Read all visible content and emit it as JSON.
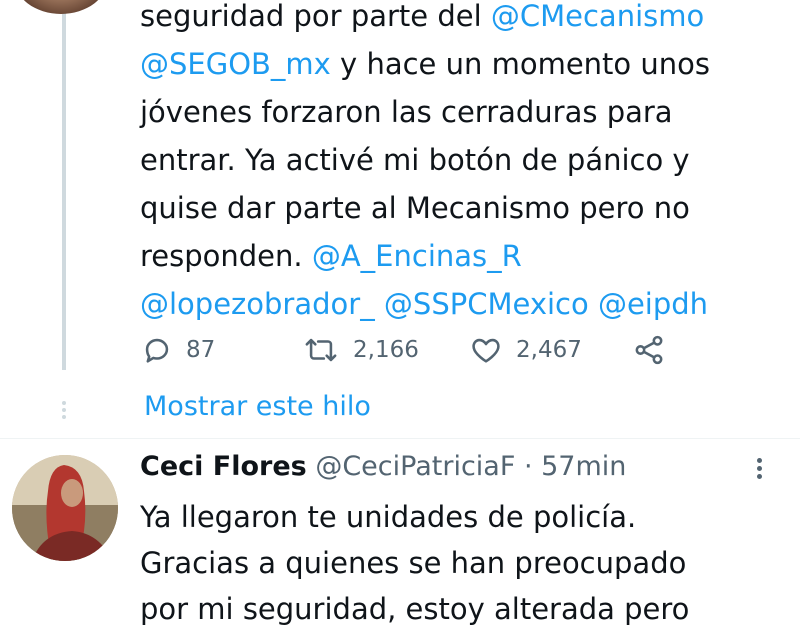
{
  "tweet1": {
    "lines": [
      [
        {
          "t": "seguridad por parte del ",
          "m": false
        },
        {
          "t": "@CMecanismo",
          "m": true
        }
      ],
      [
        {
          "t": "@SEGOB_mx",
          "m": true
        },
        {
          "t": " y hace un momento unos",
          "m": false
        }
      ],
      [
        {
          "t": "jóvenes forzaron las cerraduras para",
          "m": false
        }
      ],
      [
        {
          "t": "entrar. Ya activé mi botón de pánico y",
          "m": false
        }
      ],
      [
        {
          "t": "quise dar parte al Mecanismo pero no",
          "m": false
        }
      ],
      [
        {
          "t": "responden. ",
          "m": false
        },
        {
          "t": "@A_Encinas_R",
          "m": true
        }
      ],
      [
        {
          "t": "@lopezobrador_",
          "m": true
        },
        {
          "t": " ",
          "m": false
        },
        {
          "t": "@SSPCMexico",
          "m": true
        },
        {
          "t": " ",
          "m": false
        },
        {
          "t": "@eipdh",
          "m": true
        }
      ]
    ],
    "actions": {
      "reply_count": "87",
      "retweet_count": "2,166",
      "like_count": "2,467"
    },
    "icons": [
      "reply-icon",
      "retweet-icon",
      "like-icon",
      "share-icon"
    ]
  },
  "show_thread_label": "Mostrar este hilo",
  "tweet2": {
    "author_name": "Ceci Flores",
    "handle": "@CeciPatriciaF",
    "separator": " · ",
    "time": "57min",
    "lines": [
      "Ya llegaron te unidades de policía.",
      "Gracias a quienes se han preocupado",
      "por mi seguridad, estoy alterada pero"
    ]
  },
  "colors": {
    "mention": "#1d9bf0",
    "text": "#0f1419",
    "secondary": "#536471",
    "thread_line": "#cfd9de"
  }
}
